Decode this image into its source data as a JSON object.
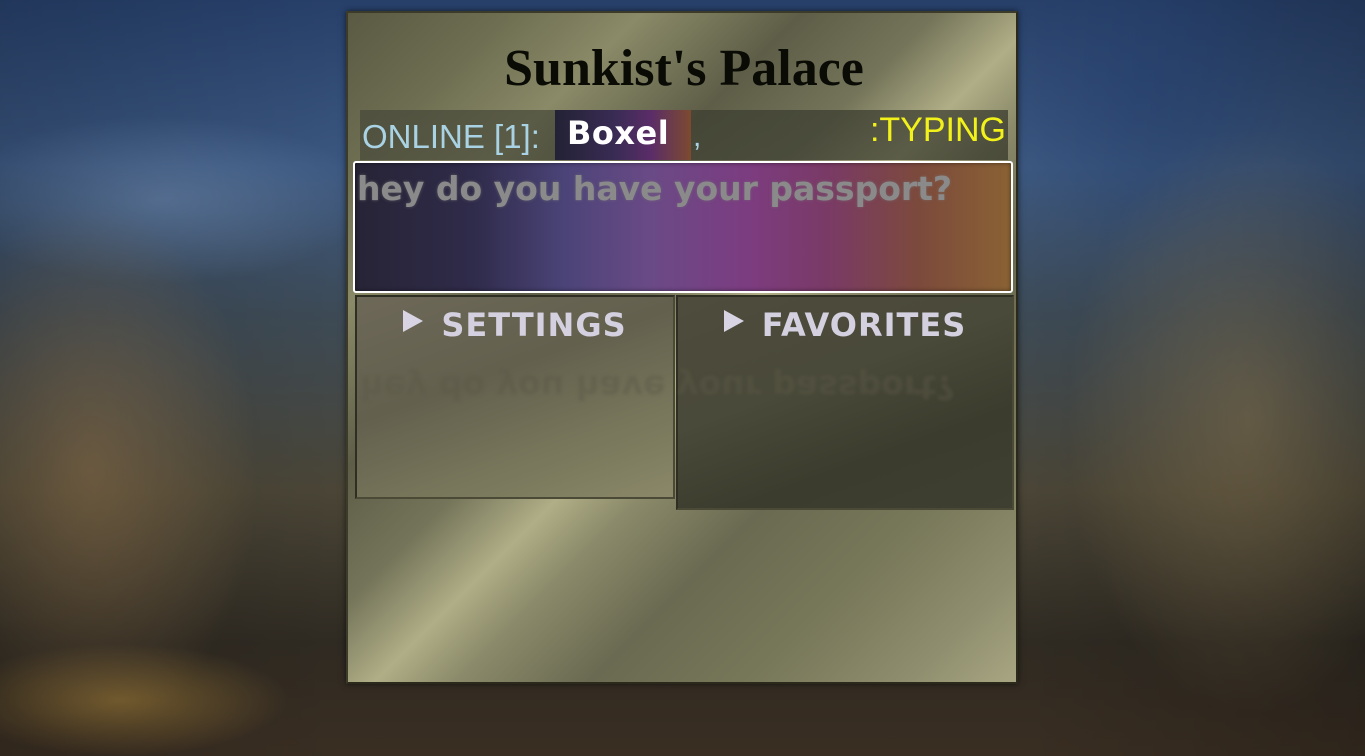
{
  "window": {
    "title": "Sunkist's Palace"
  },
  "online": {
    "label": "ONLINE [1]:",
    "users": [
      {
        "name": "Boxel"
      }
    ],
    "separator": ",",
    "typing_label": ":TYPING"
  },
  "message": {
    "text": "hey do you have your passport?"
  },
  "panels": {
    "settings_label": "SETTINGS",
    "favorites_label": "FAVORITES"
  },
  "colors": {
    "online_text": "#a9d3e4",
    "typing_text": "#f2f21a",
    "title_text": "#0b0b06",
    "panel_header_text": "#d4d0e0"
  },
  "icons": {
    "settings_expand": "triangle-right-icon",
    "favorites_expand": "triangle-right-icon"
  }
}
